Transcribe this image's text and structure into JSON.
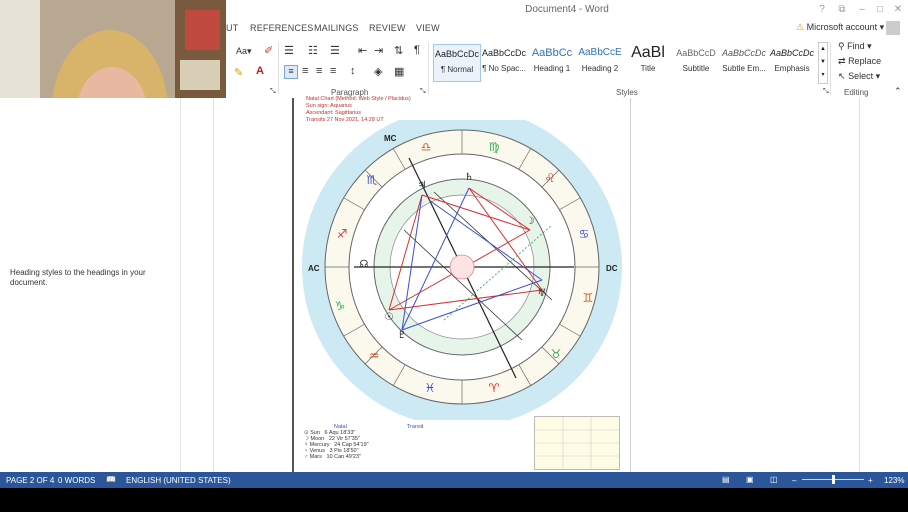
{
  "window": {
    "title": "Document4 - Word",
    "min": "–",
    "max": "□",
    "close": "✕",
    "help": "?",
    "ribbon_opts": "⧉"
  },
  "tabs": [
    {
      "label": "UT"
    },
    {
      "label": "REFERENCES"
    },
    {
      "label": "MAILINGS"
    },
    {
      "label": "REVIEW"
    },
    {
      "label": "VIEW"
    }
  ],
  "account": {
    "label": "Microsoft account"
  },
  "ribbon": {
    "paragraph_label": "Paragraph",
    "styles_label": "Styles",
    "editing_label": "Editing",
    "font_case": "Aa",
    "styles": [
      {
        "sample": "AaBbCcDc",
        "name": "¶ Normal"
      },
      {
        "sample": "AaBbCcDc",
        "name": "¶ No Spac..."
      },
      {
        "sample": "AaBbCc",
        "name": "Heading 1"
      },
      {
        "sample": "AaBbCcE",
        "name": "Heading 2"
      },
      {
        "sample": "AaBl",
        "name": "Title"
      },
      {
        "sample": "AaBbCcD",
        "name": "Subtitle"
      },
      {
        "sample": "AaBbCcDc",
        "name": "Subtle Em..."
      },
      {
        "sample": "AaBbCcDc",
        "name": "Emphasis"
      }
    ],
    "editing": {
      "find": "Find",
      "replace": "Replace",
      "select": "Select"
    }
  },
  "nav_pane": {
    "text": "Heading styles to the headings in your document."
  },
  "chart": {
    "header_lines": [
      "Natal Chart  (Method: Web Style / Placidus)",
      "Sun sign: Aquarius",
      "Ascendant: Sagittarius",
      "Transits 27 Nov 2021, 14:28 UT"
    ],
    "angles": {
      "mc": "MC",
      "ac": "AC",
      "dc": "DC"
    },
    "table_rows": [
      {
        "planet": "⊙ Sun",
        "natal": "6 Aqu 18'33\""
      },
      {
        "planet": "☽ Moon",
        "natal": "22 Vir 57'35\""
      },
      {
        "planet": "☿ Mercury",
        "natal": "24 Cap 54'19\""
      },
      {
        "planet": "♀ Venus",
        "natal": "3 Pis 18'50\""
      },
      {
        "planet": "♂ Mars",
        "natal": "10 Can 49'23\""
      }
    ],
    "table_header": {
      "natal": "Natal",
      "transit": "Transit"
    }
  },
  "statusbar": {
    "page": "PAGE 2 OF 4",
    "words": "0 WORDS",
    "language": "ENGLISH (UNITED STATES)",
    "zoom": "123%",
    "zoom_minus": "–",
    "zoom_plus": "+"
  },
  "colors": {
    "status_bg": "#2b579a",
    "chart_outer": "#cde9f3",
    "chart_red": "#d83030",
    "chart_blue": "#3a4fd0",
    "chart_green": "#3aaa55"
  }
}
